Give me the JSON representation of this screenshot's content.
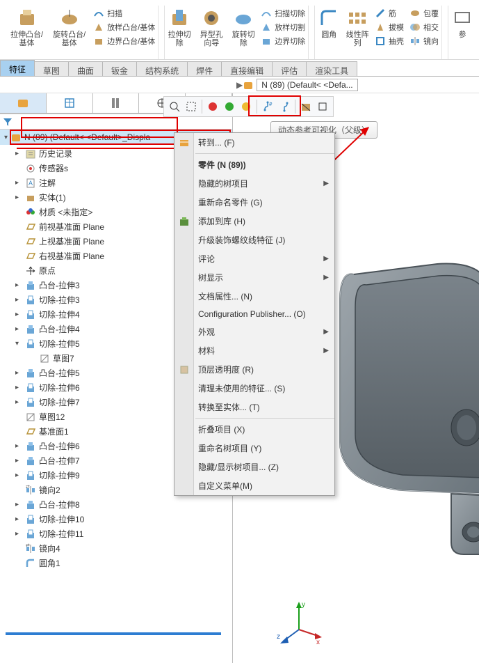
{
  "ribbon": {
    "extrude": "拉伸凸台/基体",
    "revolve": "旋转凸台/基体",
    "sweep": "扫描",
    "loft": "放样凸台/基体",
    "boundary": "边界凸台/基体",
    "extrudeCut": "拉伸切除",
    "holeWizard": "异型孔向导",
    "revolveCut": "旋转切除",
    "sweepCut": "扫描切除",
    "loftCut": "放样切割",
    "boundaryCut": "边界切除",
    "fillet": "圆角",
    "pattern": "线性阵列",
    "rib": "筋",
    "draft": "拔模",
    "shell": "抽壳",
    "wrap": "包覆",
    "intersect": "相交",
    "mirror": "镜向",
    "ref": "参"
  },
  "tabs": [
    "特征",
    "草图",
    "曲面",
    "钣金",
    "结构系统",
    "焊件",
    "直接编辑",
    "评估",
    "渲染工具"
  ],
  "activeTab": 0,
  "breadcrumb": "N (89)  (Default< <Defa...",
  "rootNode": "N (89)  (Default< <Default>_Displa",
  "tree": [
    {
      "caret": "▸",
      "icon": "history",
      "label": "历史记录"
    },
    {
      "caret": "",
      "icon": "sensor",
      "label": "传感器s"
    },
    {
      "caret": "▸",
      "icon": "note",
      "label": "注解"
    },
    {
      "caret": "▸",
      "icon": "solid",
      "label": "实体(1)"
    },
    {
      "caret": "",
      "icon": "material",
      "label": "材质 <未指定>"
    },
    {
      "caret": "",
      "icon": "plane",
      "label": "前视基准面 Plane"
    },
    {
      "caret": "",
      "icon": "plane",
      "label": "上视基准面 Plane"
    },
    {
      "caret": "",
      "icon": "plane",
      "label": "右视基准面 Plane"
    },
    {
      "caret": "",
      "icon": "origin",
      "label": "原点"
    },
    {
      "caret": "▸",
      "icon": "extrude",
      "label": "凸台-拉伸3"
    },
    {
      "caret": "▸",
      "icon": "cut",
      "label": "切除-拉伸3"
    },
    {
      "caret": "▸",
      "icon": "cut",
      "label": "切除-拉伸4"
    },
    {
      "caret": "▸",
      "icon": "extrude",
      "label": "凸台-拉伸4"
    },
    {
      "caret": "▾",
      "icon": "cut",
      "label": "切除-拉伸5"
    },
    {
      "caret": "",
      "icon": "sketch",
      "label": "草图7",
      "indent": true
    },
    {
      "caret": "▸",
      "icon": "extrude",
      "label": "凸台-拉伸5"
    },
    {
      "caret": "▸",
      "icon": "cut",
      "label": "切除-拉伸6"
    },
    {
      "caret": "▸",
      "icon": "cut",
      "label": "切除-拉伸7"
    },
    {
      "caret": "",
      "icon": "sketch",
      "label": "草图12"
    },
    {
      "caret": "",
      "icon": "plane",
      "label": "基准面1"
    },
    {
      "caret": "▸",
      "icon": "extrude",
      "label": "凸台-拉伸6"
    },
    {
      "caret": "▸",
      "icon": "extrude",
      "label": "凸台-拉伸7"
    },
    {
      "caret": "▸",
      "icon": "cut",
      "label": "切除-拉伸9"
    },
    {
      "caret": "",
      "icon": "mirror",
      "label": "镜向2"
    },
    {
      "caret": "▸",
      "icon": "extrude",
      "label": "凸台-拉伸8"
    },
    {
      "caret": "▸",
      "icon": "cut",
      "label": "切除-拉伸10"
    },
    {
      "caret": "▸",
      "icon": "cut",
      "label": "切除-拉伸11"
    },
    {
      "caret": "",
      "icon": "mirror",
      "label": "镜向4"
    },
    {
      "caret": "",
      "icon": "fillet",
      "label": "圆角1"
    }
  ],
  "tooltip": "动态参考可视化（父级）",
  "ctx": {
    "goto": "转到... (F)",
    "heading": "零件 (N (89))",
    "items": [
      {
        "label": "隐藏的树项目",
        "arrow": true
      },
      {
        "label": "重新命名零件  (G)"
      },
      {
        "label": "添加到库  (H)",
        "icon": "lib"
      },
      {
        "label": "升级装饰螺纹线特征  (J)"
      },
      {
        "label": "评论",
        "arrow": true
      },
      {
        "label": "树显示",
        "arrow": true
      },
      {
        "label": "文档属性...  (N)"
      },
      {
        "label": "Configuration Publisher...  (O)"
      },
      {
        "label": "外观",
        "arrow": true
      },
      {
        "label": "材料",
        "arrow": true
      },
      {
        "label": "顶层透明度  (R)",
        "icon": "trans"
      },
      {
        "label": "清理未使用的特征...  (S)"
      },
      {
        "label": "转换至实体...  (T)"
      }
    ],
    "items2": [
      {
        "label": "折叠项目  (X)"
      },
      {
        "label": "重命名树项目  (Y)"
      },
      {
        "label": "隐藏/显示树项目...  (Z)"
      },
      {
        "label": "自定义菜单(M)"
      }
    ]
  },
  "triad": {
    "x": "x",
    "y": "y",
    "z": "z"
  }
}
